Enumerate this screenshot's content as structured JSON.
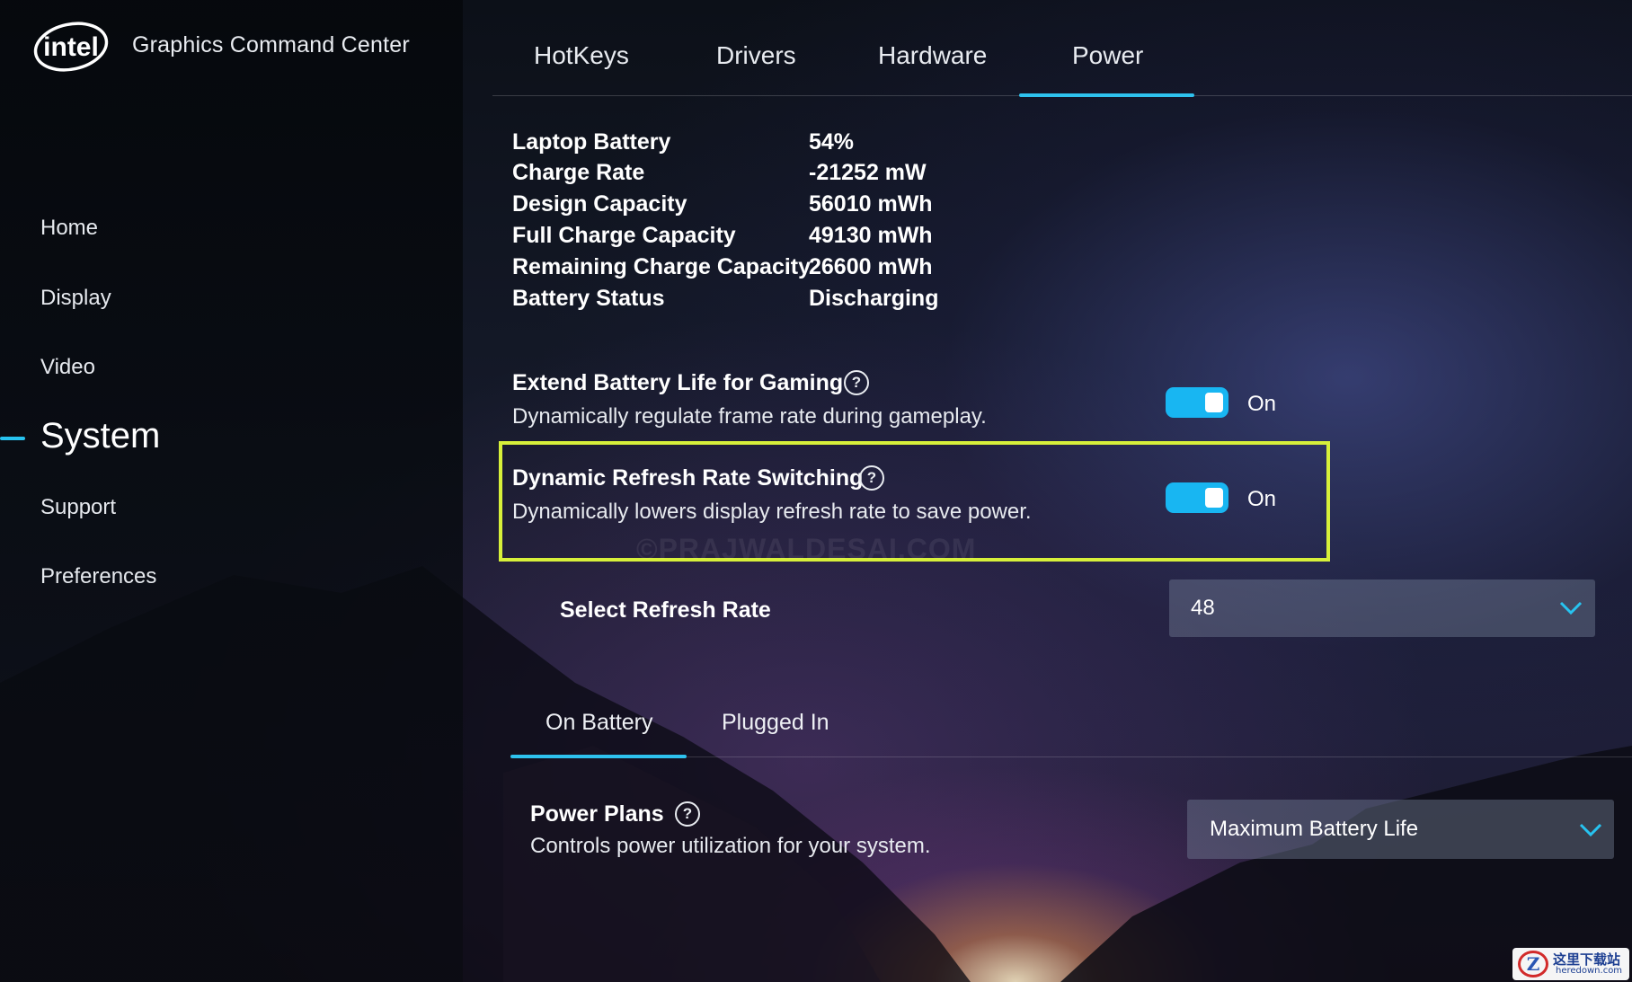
{
  "app": {
    "brand": "intel",
    "title": "Graphics Command Center"
  },
  "sidebar": {
    "items": [
      {
        "label": "Home"
      },
      {
        "label": "Display"
      },
      {
        "label": "Video"
      },
      {
        "label": "System",
        "active": true
      },
      {
        "label": "Support"
      },
      {
        "label": "Preferences"
      }
    ]
  },
  "top_tabs": [
    {
      "label": "HotKeys"
    },
    {
      "label": "Drivers"
    },
    {
      "label": "Hardware"
    },
    {
      "label": "Power",
      "active": true
    }
  ],
  "battery_info": [
    {
      "label": "Laptop Battery",
      "value": "54%"
    },
    {
      "label": "Charge Rate",
      "value": "-21252 mW"
    },
    {
      "label": "Design Capacity",
      "value": "56010 mWh"
    },
    {
      "label": "Full Charge Capacity",
      "value": "49130 mWh"
    },
    {
      "label": "Remaining Charge Capacity",
      "value": "26600 mWh"
    },
    {
      "label": "Battery Status",
      "value": "Discharging"
    }
  ],
  "settings": {
    "extend_battery": {
      "title": "Extend Battery Life for Gaming",
      "description": "Dynamically regulate frame rate during gameplay.",
      "state": "On"
    },
    "dynamic_refresh": {
      "title": "Dynamic Refresh Rate Switching",
      "description": "Dynamically lowers display refresh rate to save power.",
      "state": "On"
    },
    "select_refresh_rate": {
      "label": "Select Refresh Rate",
      "value": "48"
    }
  },
  "watermark": "©PRAJWALDESAI.COM",
  "power_tabs": [
    {
      "label": "On Battery",
      "active": true
    },
    {
      "label": "Plugged In"
    }
  ],
  "power_plans": {
    "title": "Power Plans",
    "description": "Controls power utilization for your system.",
    "value": "Maximum Battery Life"
  },
  "corner_badge": {
    "mark": "Z",
    "text": "这里下载站",
    "sub": "heredown.com"
  },
  "colors": {
    "accent": "#2ec2ee",
    "toggle": "#18b6f2",
    "highlight": "#d7f03a"
  },
  "icons": {
    "help": "question-circle-icon",
    "dropdown": "chevron-down-icon"
  }
}
